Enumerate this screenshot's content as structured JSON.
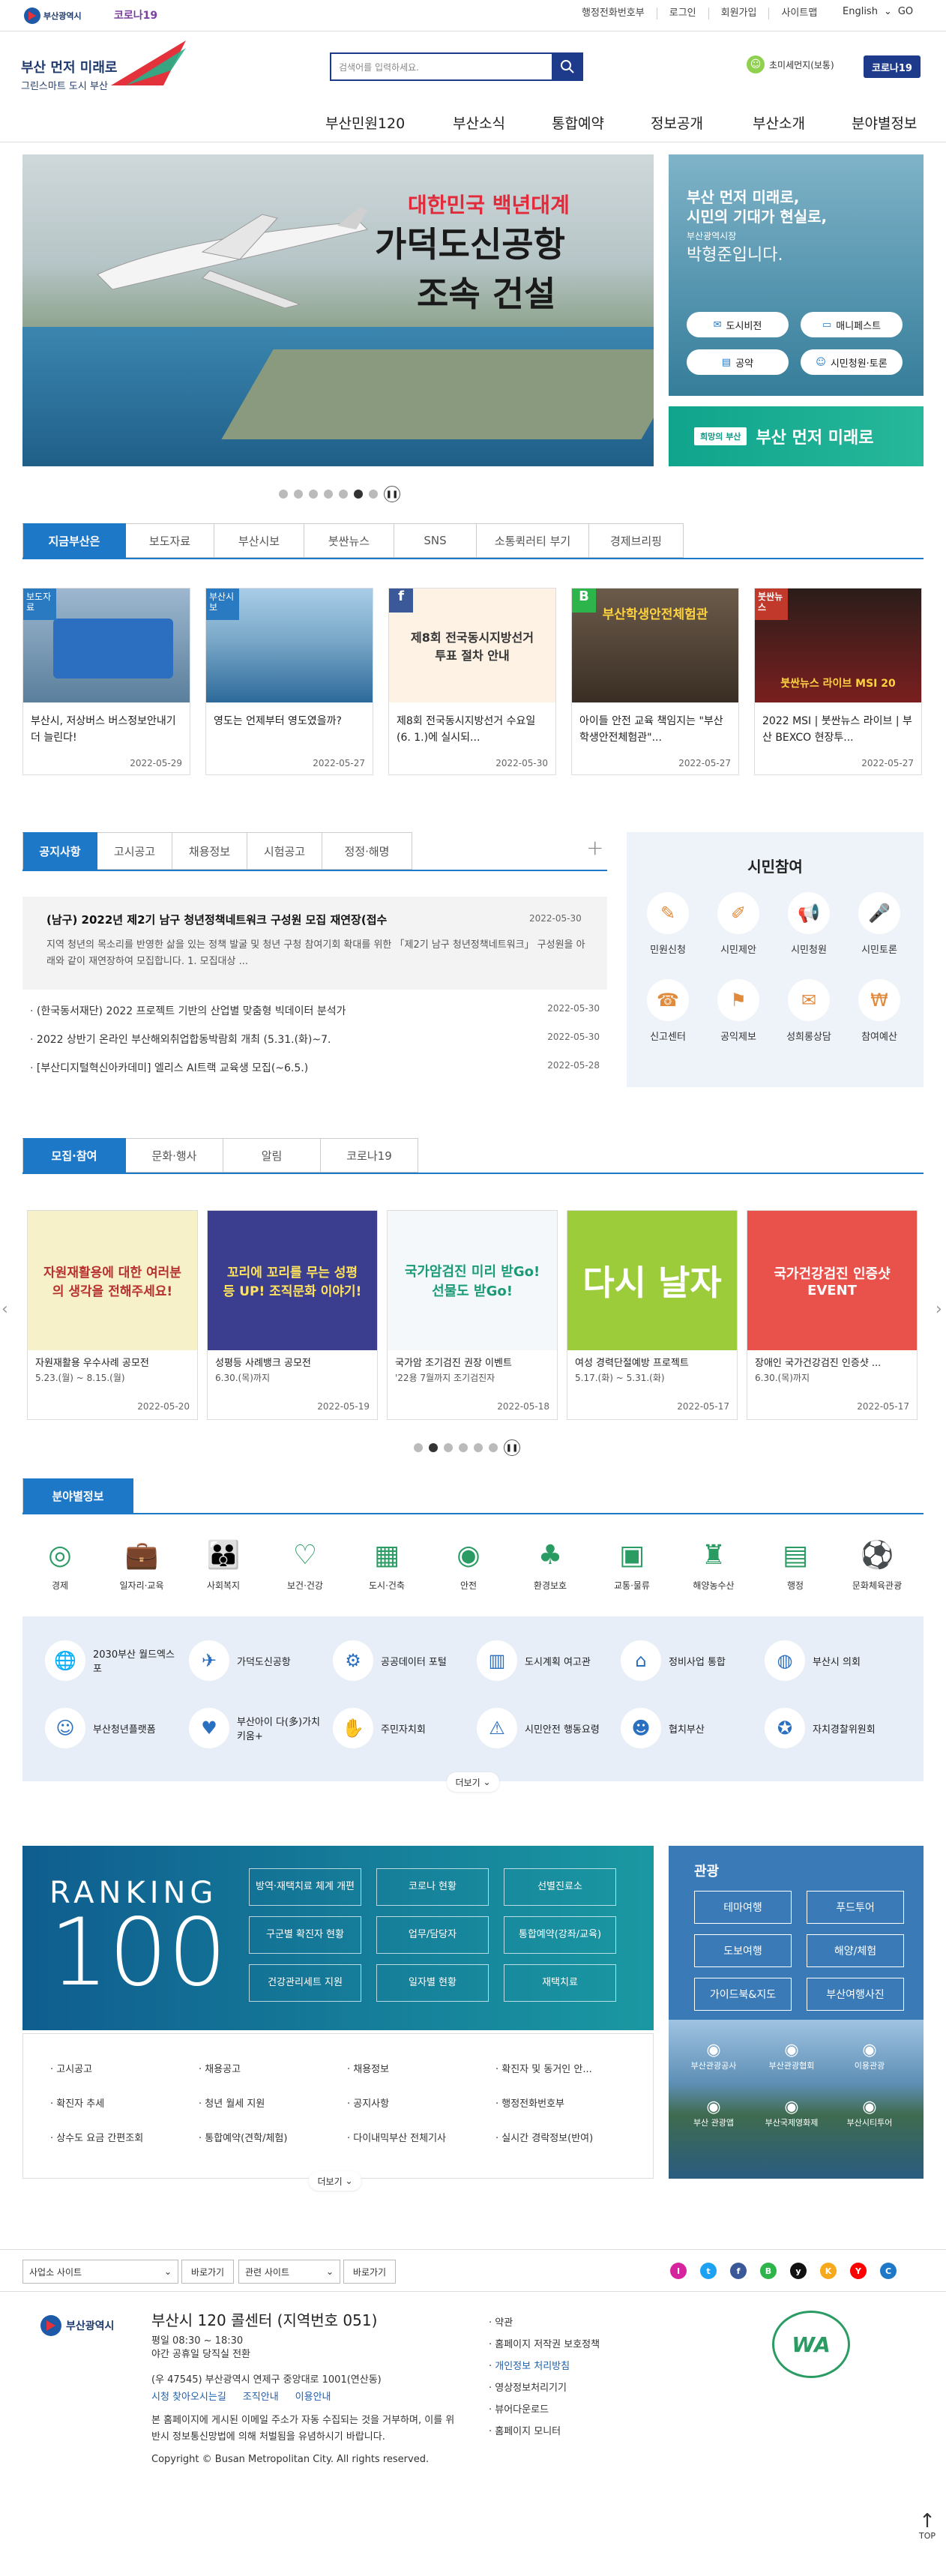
{
  "top": {
    "logo_text": "부산광역시",
    "corona": "코로나19",
    "links": [
      "행정전화번호부",
      "로그인",
      "회원가입",
      "사이트맵"
    ],
    "lang": "English",
    "go": "GO"
  },
  "header": {
    "slogan1": "부산 먼저 미래로",
    "slogan2": "그린스마트 도시 부산",
    "search_placeholder": "검색어를 입력하세요.",
    "user": "초미세먼지(보통)",
    "corona_btn": "코로나19"
  },
  "gnb": [
    "부산민원120",
    "부산소식",
    "통합예약",
    "정보공개",
    "부산소개",
    "분야별정보"
  ],
  "hero": {
    "line1": "대한민국 백년대계",
    "line2": "가덕도신공항",
    "line3": "조속 건설",
    "dots_total": 7,
    "dots_active": 6
  },
  "mayor": {
    "line1": "부산 먼저 미래로,",
    "line2": "시민의 기대가 현실로,",
    "title": "부산광역시장",
    "name": "박형준입니다.",
    "buttons": [
      "도시비전",
      "매니페스트",
      "공약",
      "시민청원·토론"
    ],
    "banner_tag": "희망의 부산",
    "banner_text": "부산 먼저 미래로"
  },
  "news": {
    "tabs": [
      "지금부산은",
      "보도자료",
      "부산시보",
      "붓싼뉴스",
      "SNS",
      "소통퀵러티 부기",
      "경제브리핑"
    ],
    "cards": [
      {
        "badge": "보도자료",
        "caption": "부산시, 저상버스 버스정보안내기 더 늘린다!",
        "date": "2022-05-29",
        "color": "#2a7ac2"
      },
      {
        "badge": "부산시보",
        "caption": "영도는 언제부터 영도였을까?",
        "date": "2022-05-27",
        "color": "#2a7ac2"
      },
      {
        "badge": "f",
        "caption": "제8회 전국동시지방선거 수요일(6. 1.)에 실시되...",
        "date": "2022-05-30",
        "color": "#3b5998",
        "img_text": "제8회 전국동시지방선거 투표 절차 안내"
      },
      {
        "badge": "B",
        "caption": "아이들 안전 교육 책임지는 \"부산학생안전체험관\"...",
        "date": "2022-05-27",
        "color": "#2db44a",
        "img_text": "부산학생안전체험관"
      },
      {
        "badge": "붓싼뉴스",
        "caption": "2022 MSI | 붓싼뉴스 라이브 | 부산 BEXCO 현장투...",
        "date": "2022-05-27",
        "color": "#c0392b",
        "img_text": "붓싼뉴스 라이브 MSI 20"
      }
    ]
  },
  "notice": {
    "tabs": [
      "공지사항",
      "고시공고",
      "채용정보",
      "시험공고",
      "정정·해명"
    ],
    "plus": "+",
    "featured_title": "(남구) 2022년 제2기 남구 청년정책네트워크 구성원 모집 재연장(접수",
    "featured_date": "2022-05-30",
    "featured_body": "지역 청년의 목소리를 반영한 삶을 있는 정책 발굴 및 청년 구청 참여기회 확대를 위한 「제2기 남구 청년정책네트워크」 구성원을 아래와 같이 재연장하여 모집합니다. 1. 모집대상 ...",
    "items": [
      {
        "title": "(한국동서재단) 2022 프로젝트 기반의 산업별 맞춤형 빅데이터 분석가",
        "date": "2022-05-30"
      },
      {
        "title": "2022 상반기 온라인 부산해외취업합동박람회 개최 (5.31.(화)~7.",
        "date": "2022-05-30"
      },
      {
        "title": "[부산디지털혁신아카데미] 엘리스 AI트랙 교육생 모집(~6.5.)",
        "date": "2022-05-28"
      }
    ]
  },
  "civic": {
    "title": "시민참여",
    "items": [
      {
        "label": "민원신청",
        "icon": "document-icon"
      },
      {
        "label": "시민제안",
        "icon": "pen-icon"
      },
      {
        "label": "시민청원",
        "icon": "megaphone-icon"
      },
      {
        "label": "시민토론",
        "icon": "mic-icon"
      },
      {
        "label": "신고센터",
        "icon": "phone-icon"
      },
      {
        "label": "공익제보",
        "icon": "whistle-icon"
      },
      {
        "label": "성희롱상담",
        "icon": "chat-icon"
      },
      {
        "label": "참여예산",
        "icon": "budget-icon"
      }
    ]
  },
  "recruit": {
    "tabs": [
      "모집·참여",
      "문화·행사",
      "알림",
      "코로나19"
    ],
    "cards": [
      {
        "caption": "자원재활용 우수사례 공모전",
        "sub": "5.23.(월) ~ 8.15.(월)",
        "date": "2022-05-20",
        "bg": "#f6f1c8",
        "img_text": "자원재활용에 대한 여러분의 생각을 전해주세요!"
      },
      {
        "caption": "성평등 사례뱅크 공모전",
        "sub": "6.30.(목)까지",
        "date": "2022-05-19",
        "bg": "#3b3d8e",
        "img_text": "꼬리에 꼬리를 무는 성평등 UP! 조직문화 이야기!"
      },
      {
        "caption": "국가암 조기검진 권장 이벤트",
        "sub": "'22용 7월까지 조기검진자",
        "date": "2022-05-18",
        "bg": "#f5f8fb",
        "img_text": "국가암검진 미리 받Go! 선물도 받Go!"
      },
      {
        "caption": "여성 경력단절예방 프로젝트",
        "sub": "5.17.(화) ~ 5.31.(화)",
        "date": "2022-05-17",
        "bg": "#9ccc3a",
        "img_text": "다시 날자"
      },
      {
        "caption": "장애인 국가건강검진 인증샷 ...",
        "sub": "6.30.(목)까지",
        "date": "2022-05-17",
        "bg": "#e9524a",
        "img_text": "국가건강검진 인증샷 EVENT"
      }
    ],
    "dots_total": 6,
    "dots_active": 2
  },
  "field": {
    "title": "분야별정보",
    "cats": [
      {
        "label": "경제",
        "icon": "coin-icon"
      },
      {
        "label": "일자리·교육",
        "icon": "briefcase-icon"
      },
      {
        "label": "사회복지",
        "icon": "family-icon"
      },
      {
        "label": "보건·건강",
        "icon": "heart-icon"
      },
      {
        "label": "도시·건축",
        "icon": "building-icon"
      },
      {
        "label": "안전",
        "icon": "lifebuoy-icon"
      },
      {
        "label": "환경보호",
        "icon": "tree-icon"
      },
      {
        "label": "교통·물류",
        "icon": "bus-icon"
      },
      {
        "label": "해양농수산",
        "icon": "lighthouse-icon"
      },
      {
        "label": "행정",
        "icon": "clipboard-icon"
      },
      {
        "label": "문화체육관광",
        "icon": "ball-icon"
      }
    ],
    "services": [
      {
        "label": "2030부산 월드엑스포",
        "icon": "globe-icon"
      },
      {
        "label": "가덕도신공항",
        "icon": "airplane-icon"
      },
      {
        "label": "공공데이터 포털",
        "icon": "data-icon"
      },
      {
        "label": "도시계획 여고관",
        "icon": "chart-icon"
      },
      {
        "label": "정비사업 통합",
        "icon": "home-icon"
      },
      {
        "label": "부산시 의회",
        "icon": "council-icon"
      },
      {
        "label": "부산청년플랫폼",
        "icon": "youth-icon"
      },
      {
        "label": "부산아이 다(多)가치키움+",
        "icon": "baby-icon"
      },
      {
        "label": "주민자치회",
        "icon": "handshake-icon"
      },
      {
        "label": "시민안전 행동요령",
        "icon": "warning-icon"
      },
      {
        "label": "협치부산",
        "icon": "people-icon"
      },
      {
        "label": "자치경찰위원회",
        "icon": "police-icon"
      }
    ],
    "more": "더보기"
  },
  "ranking": {
    "word": "RANKING",
    "num": "100",
    "buttons": [
      "방역·재택치료 체계 개편",
      "코로나 현황",
      "선별진료소",
      "구군별 확진자 현황",
      "업무/담당자",
      "통합예약(강좌/교육)",
      "건강관리세트 지원",
      "일자별 현황",
      "재택치료"
    ],
    "links": [
      "고시공고",
      "채용공고",
      "채용정보",
      "확진자 및 동거인 안...",
      "확진자 추세",
      "청년 월세 지원",
      "공지사항",
      "행정전화번호부",
      "상수도 요금 간편조회",
      "통합예약(견학/체험)",
      "다이내믹부산 전체기사",
      "실시간 경락정보(반여)"
    ],
    "more": "더보기"
  },
  "tour": {
    "title": "관광",
    "buttons": [
      "테마여행",
      "푸드투어",
      "도보여행",
      "해양/체험",
      "가이드북&지도",
      "부산여행사진"
    ],
    "icons": [
      "부산관광공사",
      "부산관광협회",
      "이용관광",
      "부산 관광앱",
      "부산국제영화제",
      "부산시티투어"
    ]
  },
  "footer": {
    "select1": "사업소 사이트",
    "select2": "관련 사이트",
    "go": "바로가기",
    "logo_text": "부산광역시",
    "call_title": "부산시 120 콜센터 (지역번호 051)",
    "hours1": "평일 08:30 ~ 18:30",
    "hours2": "야간 공휴일 당직실 전환",
    "address": "(우 47545) 부산광역시 연제구 중앙대로 1001(연산동)",
    "sub_links": [
      "시청 찾아오시는길",
      "조직안내",
      "이용안내"
    ],
    "notice": "본 홈페이지에 게시된 이메일 주소가 자동 수집되는 것을 거부하며, 이를 위반시 정보통신망법에 의해 처벌됨을 유념하시기 바랍니다.",
    "copyright": "Copyright © Busan Metropolitan City. All rights reserved.",
    "policies": [
      "약관",
      "홈페이지 저작권 보호정책",
      "개인정보 처리방침",
      "영상정보처리기기",
      "뷰어다운로드",
      "홈페이지 모니터"
    ],
    "wa_label": "WA",
    "top": "TOP"
  },
  "sns": [
    "I",
    "t",
    "f",
    "B",
    "y",
    "K",
    "Y",
    "C"
  ]
}
